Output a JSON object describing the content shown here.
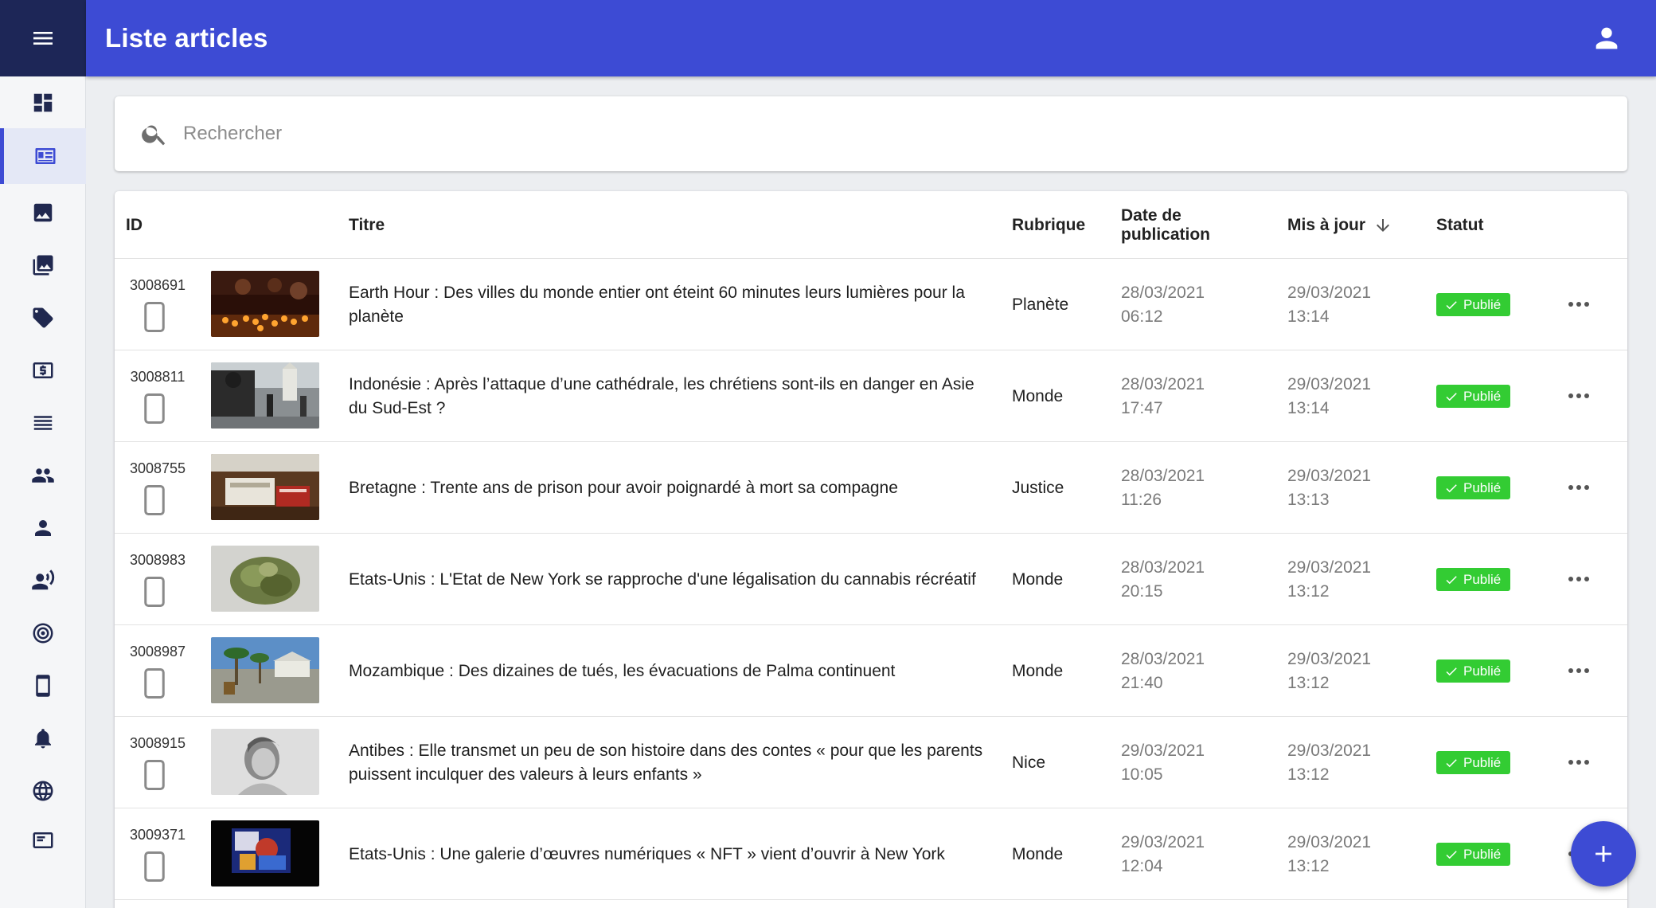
{
  "app": {
    "title": "Liste articles",
    "accent_color": "#3d4bd4",
    "rail_header_color": "#1d2657",
    "status_color": "#33cc33"
  },
  "sidebar": {
    "items": [
      {
        "icon": "dashboard-icon",
        "active": false
      },
      {
        "icon": "newspaper-icon",
        "active": true
      },
      {
        "icon": "image-icon",
        "active": false
      },
      {
        "icon": "photo-library-icon",
        "active": false
      },
      {
        "icon": "tag-icon",
        "active": false
      },
      {
        "icon": "dollar-icon",
        "active": false
      },
      {
        "icon": "list-icon",
        "active": false
      },
      {
        "icon": "group-icon",
        "active": false
      },
      {
        "icon": "person-icon",
        "active": false
      },
      {
        "icon": "speaker-person-icon",
        "active": false
      },
      {
        "icon": "target-icon",
        "active": false
      },
      {
        "icon": "smartphone-icon",
        "active": false
      },
      {
        "icon": "bell-icon",
        "active": false
      },
      {
        "icon": "globe-icon",
        "active": false
      },
      {
        "icon": "card-icon",
        "active": false
      }
    ]
  },
  "search": {
    "placeholder": "Rechercher"
  },
  "table": {
    "headers": {
      "id": "ID",
      "title": "Titre",
      "rubrique": "Rubrique",
      "date_pub": "Date de publication",
      "maj": "Mis à jour",
      "statut": "Statut"
    },
    "sort_column": "maj",
    "sort_direction": "desc",
    "rows": [
      {
        "id": "3008691",
        "title": "Earth Hour : Des villes du monde entier ont éteint 60 minutes leurs lumières pour la planète",
        "rubrique": "Planète",
        "date_pub_date": "28/03/2021",
        "date_pub_time": "06:12",
        "maj_date": "29/03/2021",
        "maj_time": "13:14",
        "statut": "Publié",
        "thumb": "candles"
      },
      {
        "id": "3008811",
        "title": "Indonésie : Après l’attaque d’une cathédrale, les chrétiens sont-ils en danger en Asie du Sud-Est ?",
        "rubrique": "Monde",
        "date_pub_date": "28/03/2021",
        "date_pub_time": "17:47",
        "maj_date": "29/03/2021",
        "maj_time": "13:14",
        "statut": "Publié",
        "thumb": "street"
      },
      {
        "id": "3008755",
        "title": "Bretagne : Trente ans de prison pour avoir poignardé à mort sa compagne",
        "rubrique": "Justice",
        "date_pub_date": "28/03/2021",
        "date_pub_time": "11:26",
        "maj_date": "29/03/2021",
        "maj_time": "13:13",
        "statut": "Publié",
        "thumb": "court"
      },
      {
        "id": "3008983",
        "title": "Etats-Unis : L'Etat de New York se rapproche d'une légalisation du cannabis récréatif",
        "rubrique": "Monde",
        "date_pub_date": "28/03/2021",
        "date_pub_time": "20:15",
        "maj_date": "29/03/2021",
        "maj_time": "13:12",
        "statut": "Publié",
        "thumb": "cannabis"
      },
      {
        "id": "3008987",
        "title": "Mozambique : Des dizaines de tués, les évacuations de Palma continuent",
        "rubrique": "Monde",
        "date_pub_date": "28/03/2021",
        "date_pub_time": "21:40",
        "maj_date": "29/03/2021",
        "maj_time": "13:12",
        "statut": "Publié",
        "thumb": "palms"
      },
      {
        "id": "3008915",
        "title": "Antibes : Elle transmet un peu de son histoire dans des contes « pour que les parents puissent inculquer des valeurs à leurs enfants »",
        "rubrique": "Nice",
        "date_pub_date": "29/03/2021",
        "date_pub_time": "10:05",
        "maj_date": "29/03/2021",
        "maj_time": "13:12",
        "statut": "Publié",
        "thumb": "portrait"
      },
      {
        "id": "3009371",
        "title": "Etats-Unis : Une galerie d’œuvres numériques « NFT » vient d’ouvrir à New York",
        "rubrique": "Monde",
        "date_pub_date": "29/03/2021",
        "date_pub_time": "12:04",
        "maj_date": "29/03/2021",
        "maj_time": "13:12",
        "statut": "Publié",
        "thumb": "gallery"
      }
    ]
  }
}
